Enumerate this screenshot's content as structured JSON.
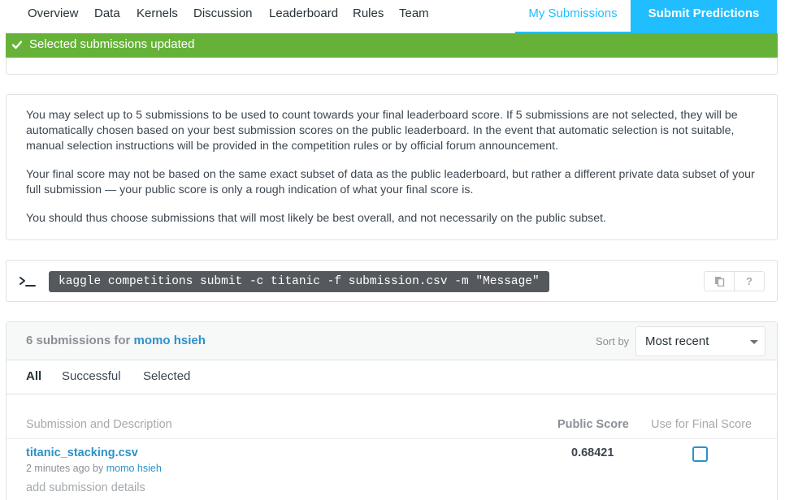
{
  "nav": {
    "items": [
      "Overview",
      "Data",
      "Kernels",
      "Discussion",
      "Leaderboard",
      "Rules",
      "Team"
    ],
    "my_submissions": "My Submissions",
    "submit_predictions": "Submit Predictions",
    "accent_color": "#20beff"
  },
  "alert": {
    "text": "Selected submissions updated",
    "color": "#66b238",
    "icon": "check-icon"
  },
  "info": {
    "p1": "You may select up to 5 submissions to be used to count towards your final leaderboard score. If 5 submissions are not selected, they will be automatically chosen based on your best submission scores on the public leaderboard. In the event that automatic selection is not suitable, manual selection instructions will be provided in the competition rules or by official forum announcement.",
    "p2": "Your final score may not be based on the same exact subset of data as the public leaderboard, but rather a different private data subset of your full submission — your public score is only a rough indication of what your final score is.",
    "p3": "You should thus choose submissions that will most likely be best overall, and not necessarily on the public subset."
  },
  "command": {
    "prompt_icon": "terminal-prompt-icon",
    "code": "kaggle competitions submit -c titanic -f submission.csv -m \"Message\"",
    "copy_icon": "copy-icon",
    "help_label": "?"
  },
  "submissions": {
    "count_label": "6 submissions for",
    "user": "momo hsieh",
    "sort_label": "Sort by",
    "sort_value": "Most recent",
    "tabs": [
      "All",
      "Successful",
      "Selected"
    ],
    "columns": {
      "description": "Submission and Description",
      "public_score": "Public Score",
      "final": "Use for Final Score"
    },
    "rows": [
      {
        "file": "titanic_stacking.csv",
        "time": "2 minutes ago",
        "by": "by",
        "user": "momo hsieh",
        "add_details": "add submission details",
        "score": "0.68421",
        "selected": false
      }
    ]
  }
}
